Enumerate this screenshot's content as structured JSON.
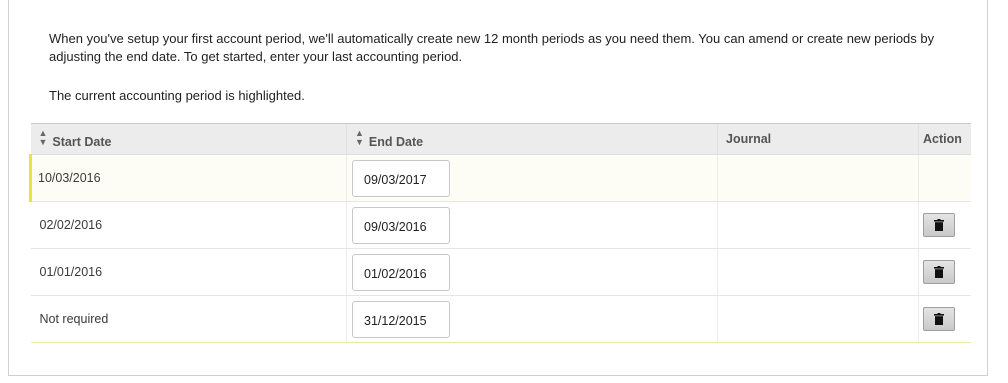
{
  "intro": {
    "paragraph1": "When you've setup your first account period, we'll automatically create new 12 month periods as you need them. You can amend or create new periods by adjusting the end date. To get started, enter your last accounting period.",
    "paragraph2": "The current accounting period is highlighted."
  },
  "table": {
    "headers": {
      "start_date": "Start Date",
      "end_date": "End Date",
      "journal": "Journal",
      "action": "Action"
    },
    "sort_icon": "sort-icon",
    "delete_icon": "trash-icon",
    "highlight_color": "#e9e34a",
    "rows": [
      {
        "start_date": "10/03/2016",
        "end_date": "09/03/2017",
        "journal": "",
        "current": true,
        "deletable": false
      },
      {
        "start_date": "02/02/2016",
        "end_date": "09/03/2016",
        "journal": "",
        "current": false,
        "deletable": true
      },
      {
        "start_date": "01/01/2016",
        "end_date": "01/02/2016",
        "journal": "",
        "current": false,
        "deletable": true
      },
      {
        "start_date": "Not required",
        "end_date": "31/12/2015",
        "journal": "",
        "current": false,
        "deletable": true
      }
    ]
  }
}
